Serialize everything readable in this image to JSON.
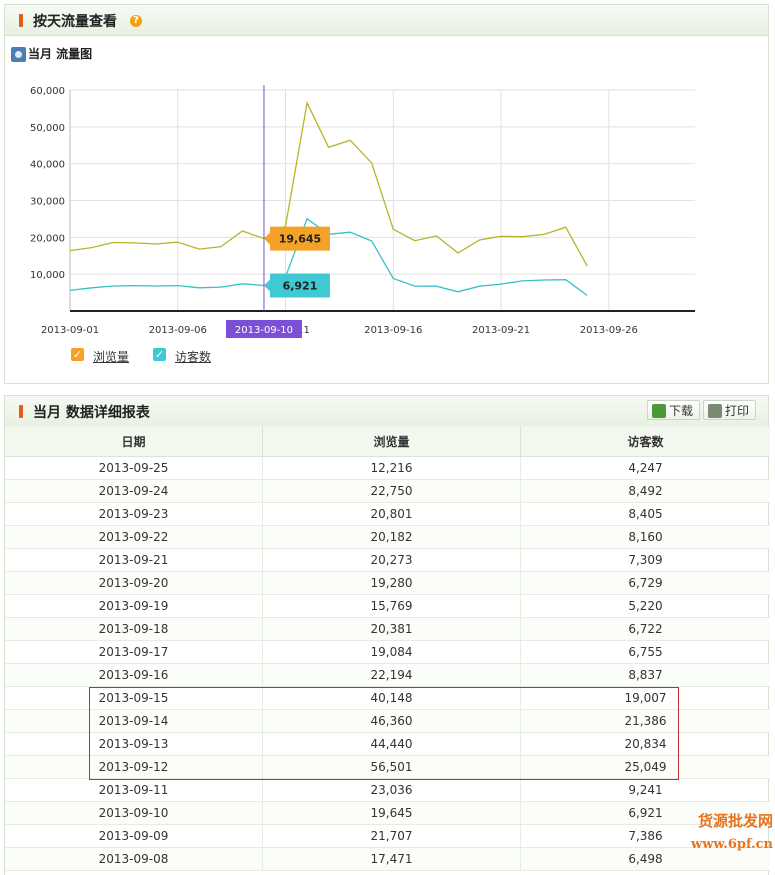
{
  "section1": {
    "title": "按天流量查看",
    "help_icon": "question-icon"
  },
  "chart_section": {
    "subtitle": "当月 流量图",
    "icon": "chart-camera-icon"
  },
  "chart_data": {
    "type": "line",
    "x": [
      "2013-09-01",
      "2013-09-02",
      "2013-09-03",
      "2013-09-04",
      "2013-09-05",
      "2013-09-06",
      "2013-09-07",
      "2013-09-08",
      "2013-09-09",
      "2013-09-10",
      "2013-09-11",
      "2013-09-12",
      "2013-09-13",
      "2013-09-14",
      "2013-09-15",
      "2013-09-16",
      "2013-09-17",
      "2013-09-18",
      "2013-09-19",
      "2013-09-20",
      "2013-09-21",
      "2013-09-22",
      "2013-09-23",
      "2013-09-24",
      "2013-09-25"
    ],
    "x_tick_labels": [
      "2013-09-01",
      "2013-09-06",
      "2013-09-10",
      "11",
      "2013-09-16",
      "2013-09-21",
      "2013-09-26"
    ],
    "y_tick_labels": [
      "60,000",
      "50,000",
      "40,000",
      "30,000",
      "20,000",
      "10,000"
    ],
    "ylim": [
      0,
      60000
    ],
    "grid": true,
    "series": [
      {
        "name": "浏览量",
        "color": "#b8b42a",
        "values": [
          16400,
          17200,
          18600,
          18500,
          18200,
          18700,
          16800,
          17471,
          21707,
          19645,
          23036,
          56501,
          44440,
          46360,
          40148,
          22194,
          19084,
          20381,
          15769,
          19280,
          20273,
          20182,
          20801,
          22750,
          12216
        ]
      },
      {
        "name": "访客数",
        "color": "#38c0c8",
        "values": [
          5600,
          6300,
          6800,
          6900,
          6800,
          6900,
          6300,
          6498,
          7386,
          6921,
          9241,
          25049,
          20834,
          21386,
          19007,
          8837,
          6755,
          6722,
          5220,
          6729,
          7309,
          8160,
          8405,
          8492,
          4247
        ]
      }
    ],
    "crosshair_label": "2013-09-10",
    "tooltips": [
      {
        "value": "19,645",
        "color": "#f3a127"
      },
      {
        "value": "6,921",
        "color": "#3fc9d2"
      }
    ],
    "legend_placement": "bottom-left"
  },
  "legend": [
    {
      "label": "浏览量",
      "color": "#f3a127"
    },
    {
      "label": "访客数",
      "color": "#3fc9d2"
    }
  ],
  "section2": {
    "title": "当月 数据详细报表"
  },
  "toolbar": {
    "download_label": "下载",
    "print_label": "打印"
  },
  "table": {
    "headers": [
      "日期",
      "浏览量",
      "访客数"
    ],
    "rows": [
      [
        "2013-09-25",
        "12,216",
        "4,247"
      ],
      [
        "2013-09-24",
        "22,750",
        "8,492"
      ],
      [
        "2013-09-23",
        "20,801",
        "8,405"
      ],
      [
        "2013-09-22",
        "20,182",
        "8,160"
      ],
      [
        "2013-09-21",
        "20,273",
        "7,309"
      ],
      [
        "2013-09-20",
        "19,280",
        "6,729"
      ],
      [
        "2013-09-19",
        "15,769",
        "5,220"
      ],
      [
        "2013-09-18",
        "20,381",
        "6,722"
      ],
      [
        "2013-09-17",
        "19,084",
        "6,755"
      ],
      [
        "2013-09-16",
        "22,194",
        "8,837"
      ],
      [
        "2013-09-15",
        "40,148",
        "19,007"
      ],
      [
        "2013-09-14",
        "46,360",
        "21,386"
      ],
      [
        "2013-09-13",
        "44,440",
        "20,834"
      ],
      [
        "2013-09-12",
        "56,501",
        "25,049"
      ],
      [
        "2013-09-11",
        "23,036",
        "9,241"
      ],
      [
        "2013-09-10",
        "19,645",
        "6,921"
      ],
      [
        "2013-09-09",
        "21,707",
        "7,386"
      ],
      [
        "2013-09-08",
        "17,471",
        "6,498"
      ]
    ]
  },
  "watermark": {
    "line1": "货源批发网",
    "line2": "www.6pf.cn"
  }
}
